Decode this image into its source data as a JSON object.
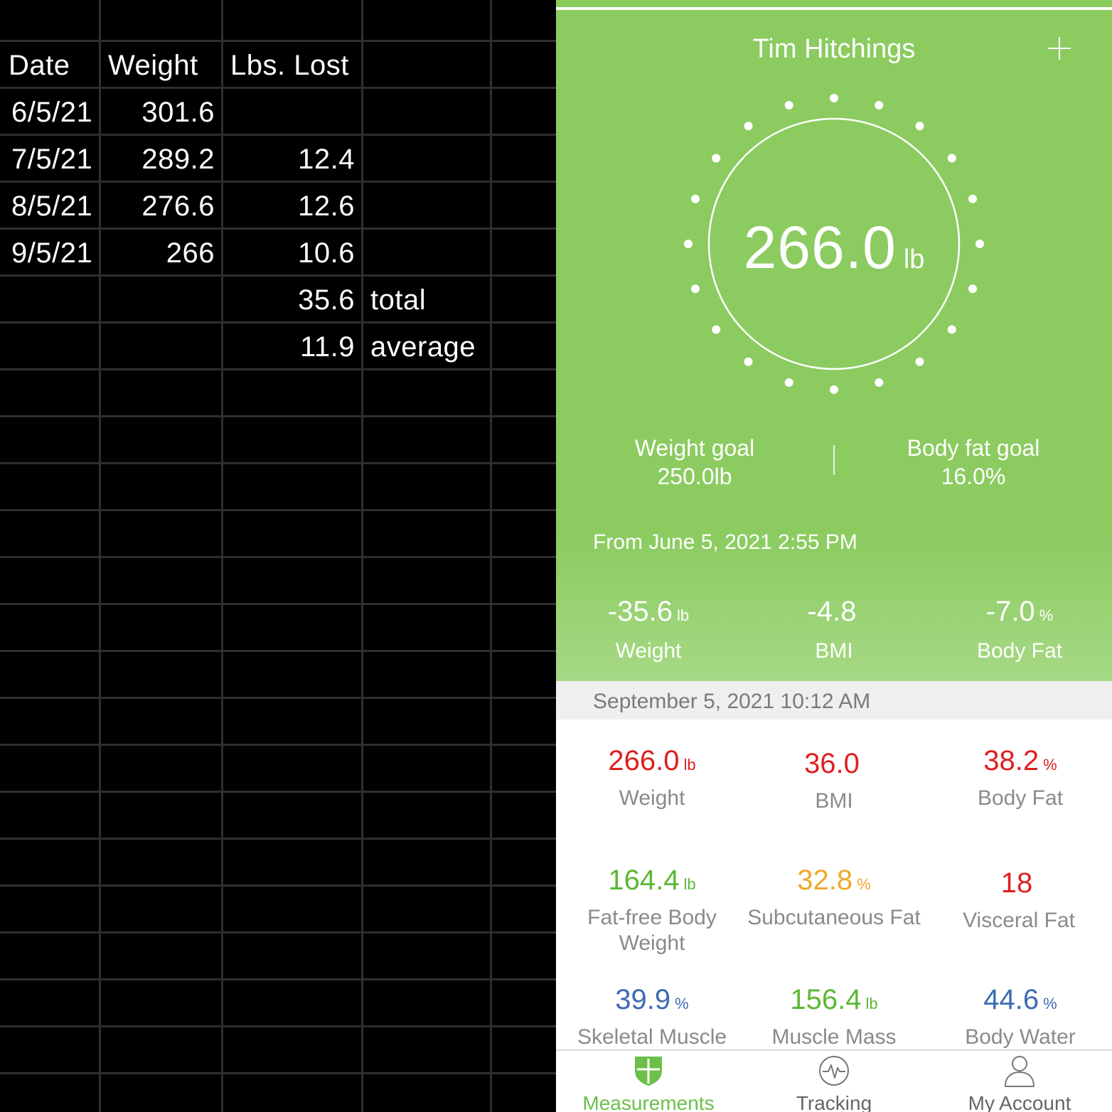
{
  "spreadsheet": {
    "headers": [
      "Date",
      "Weight",
      "Lbs. Lost"
    ],
    "rows": [
      {
        "date": "6/5/21",
        "weight": "301.6",
        "lost": ""
      },
      {
        "date": "7/5/21",
        "weight": "289.2",
        "lost": "12.4"
      },
      {
        "date": "8/5/21",
        "weight": "276.6",
        "lost": "12.6"
      },
      {
        "date": "9/5/21",
        "weight": "266",
        "lost": "10.6"
      }
    ],
    "summary": [
      {
        "value": "35.6",
        "label": "total"
      },
      {
        "value": "11.9",
        "label": "average"
      }
    ]
  },
  "app": {
    "user_name": "Tim Hitchings",
    "current_weight": "266.0",
    "current_weight_unit": "lb",
    "weight_goal_label": "Weight goal",
    "weight_goal_value": "250.0lb",
    "body_fat_goal_label": "Body fat goal",
    "body_fat_goal_value": "16.0%",
    "from_date": "From June 5, 2021 2:55 PM",
    "deltas": [
      {
        "value": "-35.6",
        "unit": "lb",
        "label": "Weight"
      },
      {
        "value": "-4.8",
        "unit": "",
        "label": "BMI"
      },
      {
        "value": "-7.0",
        "unit": "%",
        "label": "Body Fat"
      }
    ],
    "measurement_date": "September 5, 2021 10:12 AM",
    "metrics": [
      {
        "value": "266.0",
        "unit": "lb",
        "label": "Weight",
        "color": "#de1f1f"
      },
      {
        "value": "36.0",
        "unit": "",
        "label": "BMI",
        "color": "#de1f1f"
      },
      {
        "value": "38.2",
        "unit": "%",
        "label": "Body Fat",
        "color": "#de1f1f"
      },
      {
        "value": "164.4",
        "unit": "lb",
        "label": "Fat-free Body Weight",
        "color": "#5cb832"
      },
      {
        "value": "32.8",
        "unit": "%",
        "label": "Subcutaneous Fat",
        "color": "#f0a82a"
      },
      {
        "value": "18",
        "unit": "",
        "label": "Visceral Fat",
        "color": "#de1f1f"
      },
      {
        "value": "39.9",
        "unit": "%",
        "label": "Skeletal Muscle",
        "color": "#3d6bb3"
      },
      {
        "value": "156.4",
        "unit": "lb",
        "label": "Muscle Mass",
        "color": "#5cb832"
      },
      {
        "value": "44.6",
        "unit": "%",
        "label": "Body Water",
        "color": "#3d6bb3"
      }
    ],
    "nav": [
      {
        "label": "Measurements",
        "icon": "shield-icon",
        "active": true
      },
      {
        "label": "Tracking",
        "icon": "pulse-icon",
        "active": false
      },
      {
        "label": "My Account",
        "icon": "person-icon",
        "active": false
      }
    ],
    "colors": {
      "green": "#8bcb60",
      "accent_green": "#6cc04a",
      "red": "#de1f1f",
      "orange": "#f0a82a",
      "blue": "#3d6bb3"
    }
  }
}
